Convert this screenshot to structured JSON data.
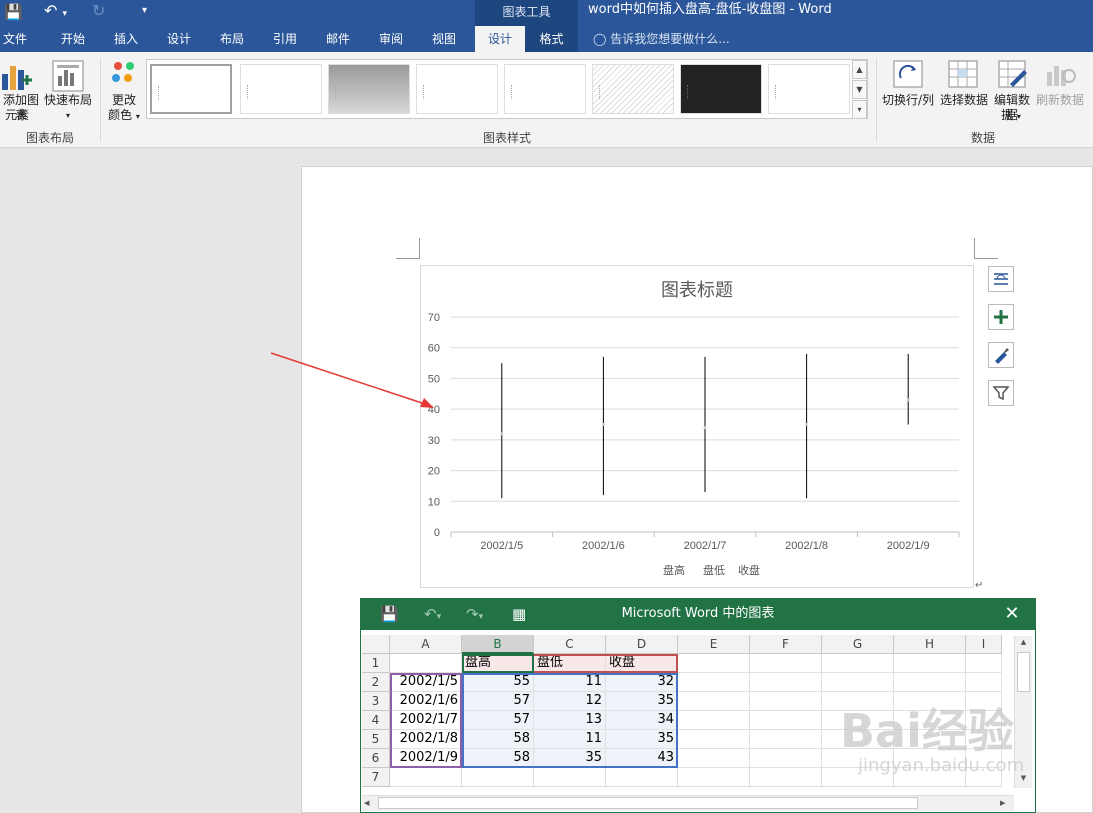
{
  "app": {
    "context_tab_group": "图表工具",
    "document_title": "word中如何插入盘高-盘低-收盘图 - Word"
  },
  "ribbon": {
    "tabs": [
      "文件",
      "开始",
      "插入",
      "设计",
      "布局",
      "引用",
      "邮件",
      "审阅",
      "视图",
      "设计",
      "格式"
    ],
    "tell_me": "告诉我您想要做什么...",
    "buttons": {
      "add_chart_element_1": "添加图表",
      "add_chart_element_2": "元素",
      "quick_layout": "快速布局",
      "change_colors_1": "更改",
      "change_colors_2": "颜色",
      "switch_row_col": "切换行/列",
      "select_data": "选择数据",
      "edit_data_1": "编辑数据",
      "edit_data_2": "据",
      "refresh_data": "刷新数据"
    },
    "groups": {
      "chart_layouts": "图表布局",
      "chart_styles": "图表样式",
      "data": "数据"
    }
  },
  "chart_data": {
    "type": "stock-high-low-close",
    "title": "图表标题",
    "categories": [
      "2002/1/5",
      "2002/1/6",
      "2002/1/7",
      "2002/1/8",
      "2002/1/9"
    ],
    "series": [
      {
        "name": "盘高",
        "values": [
          55,
          57,
          57,
          58,
          58
        ]
      },
      {
        "name": "盘低",
        "values": [
          11,
          12,
          13,
          11,
          35
        ]
      },
      {
        "name": "收盘",
        "values": [
          32,
          35,
          34,
          35,
          43
        ]
      }
    ],
    "yticks": [
      "0",
      "10",
      "20",
      "30",
      "40",
      "50",
      "60",
      "70"
    ],
    "ylim": [
      0,
      70
    ],
    "grid": true,
    "legend": "bottom",
    "colors": {
      "line": "#000000",
      "grid": "#d9d9d9",
      "text": "#595959"
    }
  },
  "excel": {
    "title": "Microsoft Word 中的图表",
    "columns": [
      "A",
      "B",
      "C",
      "D",
      "E",
      "F",
      "G",
      "H",
      "I"
    ],
    "rows": [
      "1",
      "2",
      "3",
      "4",
      "5",
      "6",
      "7"
    ],
    "header_row": [
      "",
      "盘高",
      "盘低",
      "收盘"
    ],
    "data": [
      [
        "2002/1/5",
        "55",
        "11",
        "32"
      ],
      [
        "2002/1/6",
        "57",
        "12",
        "35"
      ],
      [
        "2002/1/7",
        "57",
        "13",
        "34"
      ],
      [
        "2002/1/8",
        "58",
        "11",
        "35"
      ],
      [
        "2002/1/9",
        "58",
        "35",
        "43"
      ]
    ]
  },
  "watermark": {
    "brand": "Bai经验",
    "url": "jingyan.baidu.com"
  },
  "colors": {
    "word_blue": "#2b579a",
    "excel_green": "#217346",
    "arrow_red": "#e53935"
  }
}
